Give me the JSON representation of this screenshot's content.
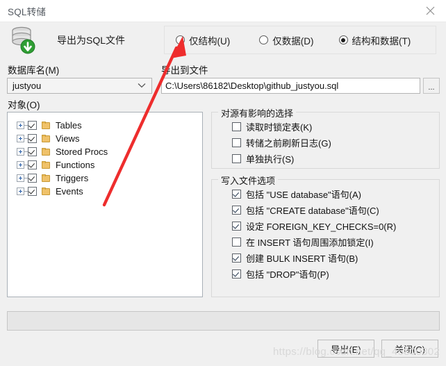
{
  "window": {
    "title": "SQL转储",
    "close_icon": "close-icon"
  },
  "header": {
    "icon": "database-export-icon",
    "label": "导出为SQL文件",
    "export_mode": {
      "selected": "structure_and_data",
      "options": [
        {
          "id": "structure_only",
          "label": "仅结构(U)",
          "checked": false
        },
        {
          "id": "data_only",
          "label": "仅数据(D)",
          "checked": false
        },
        {
          "id": "structure_and_data",
          "label": "结构和数据(T)",
          "checked": true
        }
      ]
    }
  },
  "database": {
    "label": "数据库名(M)",
    "value": "justyou",
    "dropdown_icon": "chevron-down-icon"
  },
  "output_file": {
    "label": "导出到文件",
    "value": "C:\\Users\\86182\\Desktop\\github_justyou.sql",
    "placeholder": "",
    "browse_label": "..."
  },
  "objects": {
    "label": "对象(O)",
    "items": [
      {
        "label": "Tables",
        "checked": true,
        "expandable": true
      },
      {
        "label": "Views",
        "checked": true,
        "expandable": true
      },
      {
        "label": "Stored Procs",
        "checked": true,
        "expandable": true
      },
      {
        "label": "Functions",
        "checked": true,
        "expandable": true
      },
      {
        "label": "Triggers",
        "checked": true,
        "expandable": true
      },
      {
        "label": "Events",
        "checked": true,
        "expandable": true
      }
    ]
  },
  "source_options": {
    "title": "对源有影响的选择",
    "items": [
      {
        "label": "读取时锁定表(K)",
        "checked": false
      },
      {
        "label": "转储之前刷新日志(G)",
        "checked": false
      },
      {
        "label": "单独执行(S)",
        "checked": false
      }
    ]
  },
  "write_options": {
    "title": "写入文件选项",
    "items": [
      {
        "label": "包括 \"USE database\"语句(A)",
        "checked": true
      },
      {
        "label": "包括 \"CREATE database\"语句(C)",
        "checked": true
      },
      {
        "label": "设定 FOREIGN_KEY_CHECKS=0(R)",
        "checked": true
      },
      {
        "label": "在 INSERT 语句周围添加锁定(I)",
        "checked": false
      },
      {
        "label": "创建 BULK INSERT 语句(B)",
        "checked": true
      },
      {
        "label": "包括 \"DROP\"语句(P)",
        "checked": true
      }
    ]
  },
  "footer": {
    "export_label": "导出(E)",
    "close_label": "关闭(C)"
  },
  "watermark": {
    "text": "https://blog.csdn.net/qq_45800302"
  },
  "annotation": {
    "arrow_color": "#ee2d2d",
    "points_at": "仅结构(U)"
  }
}
